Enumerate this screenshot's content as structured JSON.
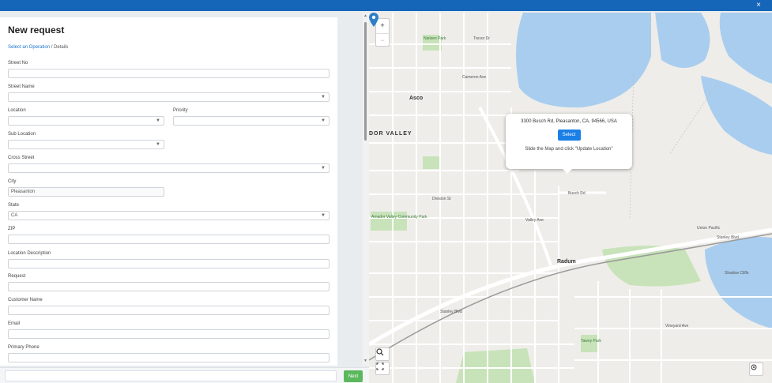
{
  "window": {
    "close_label": "×"
  },
  "form": {
    "title": "New request",
    "breadcrumb": {
      "link": "Select an Operation",
      "separator": "/",
      "current": "Details"
    },
    "fields": {
      "street_no": {
        "label": "Street No",
        "value": ""
      },
      "street_name": {
        "label": "Street Name",
        "value": ""
      },
      "location": {
        "label": "Location",
        "value": ""
      },
      "priority": {
        "label": "Priority",
        "value": ""
      },
      "sub_location": {
        "label": "Sub Location",
        "value": ""
      },
      "cross_street": {
        "label": "Cross Street",
        "value": ""
      },
      "city": {
        "label": "City",
        "value": "Pleasanton"
      },
      "state": {
        "label": "State",
        "value": "CA"
      },
      "zip": {
        "label": "ZIP",
        "value": ""
      },
      "location_description": {
        "label": "Location Description",
        "value": ""
      },
      "request": {
        "label": "Request",
        "value": ""
      },
      "customer_name": {
        "label": "Customer Name",
        "value": ""
      },
      "email": {
        "label": "Email",
        "value": ""
      },
      "primary_phone": {
        "label": "Primary Phone",
        "value": ""
      }
    },
    "next_label": "Next"
  },
  "map": {
    "zoom_in": "+",
    "zoom_out": "−",
    "popup": {
      "address": "3300 Busch Rd, Pleasanton, CA, 94566, USA",
      "select_label": "Select",
      "hint": "Slide the Map and click \"Update Location\""
    },
    "labels": {
      "asco": "Asco",
      "dor_valley": "DOR VALLEY",
      "radum": "Radum",
      "nielsen_park": "Nielsen Park",
      "amador_valley_park": "Amador Valley Community Park",
      "tawny_park": "Tawny Park",
      "shadow_cliffs": "Shadow Cliffs",
      "busch_rd": "Busch Rd",
      "stanley_blvd": "Stanley Blvd",
      "union_pacific": "Union Pacific",
      "valley_ave": "Valley Ave",
      "vineyard_ave": "Vineyard Ave",
      "cameron_ave": "Cameron Ave",
      "division_st": "Division St",
      "stoneridge": "Stanley Blvd",
      "trinity": "Trevor Dr"
    },
    "colors": {
      "water": "#a9cdee",
      "park": "#c8e3b9",
      "road": "#ffffff",
      "accent": "#1a7fe6"
    }
  }
}
